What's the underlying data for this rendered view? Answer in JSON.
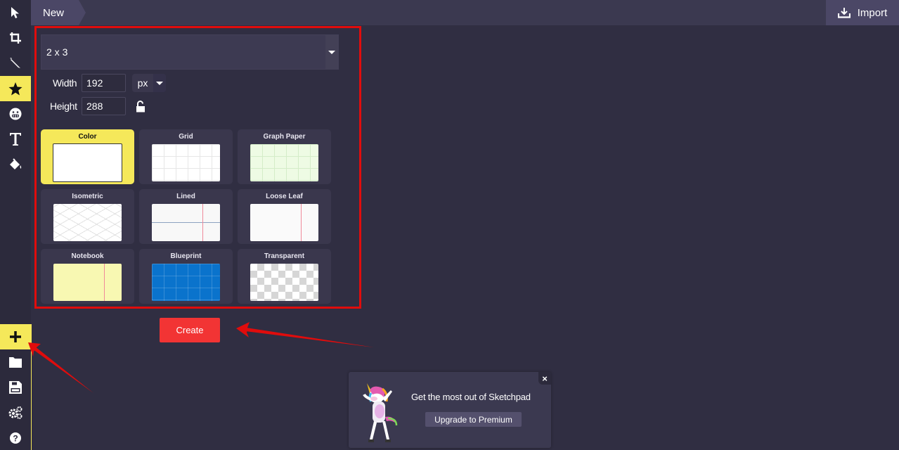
{
  "topbar": {
    "tab_label": "New",
    "import_label": "Import"
  },
  "sidebar": {
    "tools": [
      {
        "name": "select",
        "icon": "cursor-arrow-icon",
        "active": false
      },
      {
        "name": "crop",
        "icon": "crop-icon",
        "active": false
      },
      {
        "name": "draw",
        "icon": "pen-icon",
        "active": false
      },
      {
        "name": "shapes",
        "icon": "star-icon",
        "active": true
      },
      {
        "name": "stickers",
        "icon": "emoji-icon",
        "active": false
      },
      {
        "name": "text",
        "icon": "text-icon",
        "active": false
      },
      {
        "name": "fill",
        "icon": "paint-bucket-icon",
        "active": false
      }
    ],
    "bottom_tools": [
      {
        "name": "new",
        "icon": "plus-icon",
        "active": true
      },
      {
        "name": "open",
        "icon": "folder-icon",
        "active": false
      },
      {
        "name": "save",
        "icon": "save-icon",
        "active": false
      },
      {
        "name": "settings",
        "icon": "gears-icon",
        "active": false
      },
      {
        "name": "help",
        "icon": "help-icon",
        "active": false
      }
    ]
  },
  "new_canvas": {
    "size_preset": "2 x 3",
    "width_label": "Width",
    "width_value": "192",
    "height_label": "Height",
    "height_value": "288",
    "unit": "px",
    "aspect_locked": false,
    "templates": [
      {
        "label": "Color",
        "style": "color",
        "selected": true
      },
      {
        "label": "Grid",
        "style": "grid",
        "selected": false
      },
      {
        "label": "Graph Paper",
        "style": "graph",
        "selected": false
      },
      {
        "label": "Isometric",
        "style": "iso",
        "selected": false
      },
      {
        "label": "Lined",
        "style": "lined",
        "selected": false
      },
      {
        "label": "Loose Leaf",
        "style": "loose",
        "selected": false
      },
      {
        "label": "Notebook",
        "style": "notebook",
        "selected": false
      },
      {
        "label": "Blueprint",
        "style": "blueprint",
        "selected": false
      },
      {
        "label": "Transparent",
        "style": "transparent",
        "selected": false
      }
    ],
    "create_label": "Create"
  },
  "promo": {
    "headline": "Get the most out of Sketchpad",
    "button_label": "Upgrade to Premium",
    "close_label": "×"
  },
  "colors": {
    "accent_yellow": "#f5e85a",
    "create_red": "#f23434",
    "annotation_red": "#e00c0c",
    "background": "#302e42"
  }
}
